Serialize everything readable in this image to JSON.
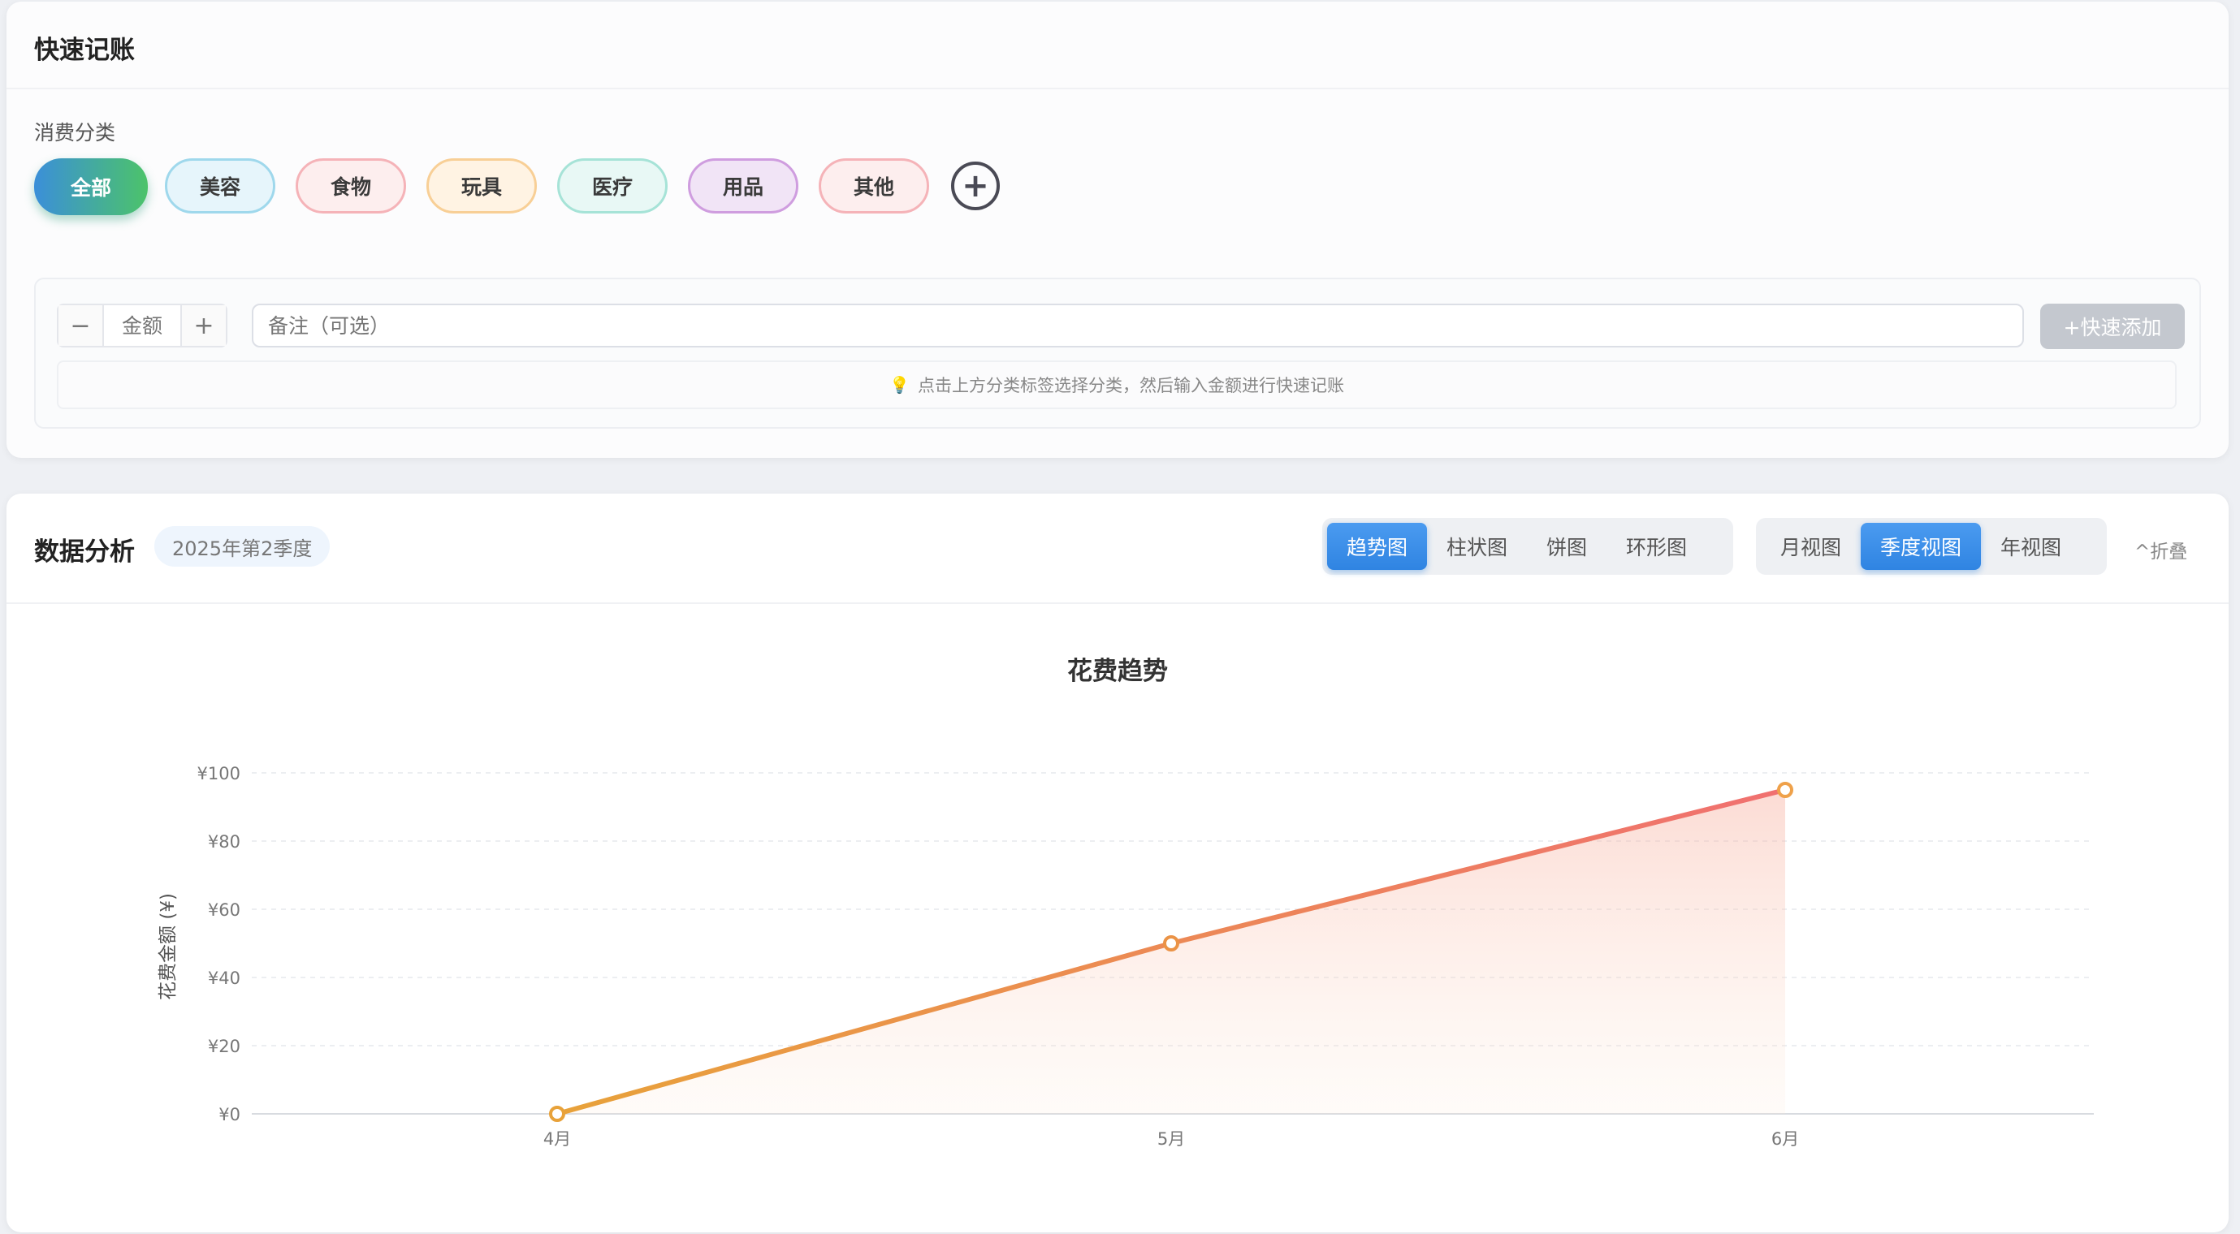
{
  "quick_add": {
    "title": "快速记账",
    "category_label": "消费分类",
    "categories": [
      {
        "label": "全部",
        "active": true,
        "bg": "#3b8fd9",
        "border": "#4cc36a"
      },
      {
        "label": "美容",
        "active": false,
        "bg": "#e6f5fb",
        "border": "#9fd8ec"
      },
      {
        "label": "食物",
        "active": false,
        "bg": "#fdeeee",
        "border": "#f5b3b8"
      },
      {
        "label": "玩具",
        "active": false,
        "bg": "#fff3e3",
        "border": "#f8cf96"
      },
      {
        "label": "医疗",
        "active": false,
        "bg": "#e8f8f5",
        "border": "#a6e3d7"
      },
      {
        "label": "用品",
        "active": false,
        "bg": "#f1e4f6",
        "border": "#cf9ddf"
      },
      {
        "label": "其他",
        "active": false,
        "bg": "#fdeeee",
        "border": "#f5b3b8"
      }
    ],
    "add_category_icon": "+",
    "minus_label": "−",
    "plus_label": "+",
    "amount_placeholder": "金额",
    "note_placeholder": "备注（可选）",
    "submit_label": "+快速添加",
    "hint_icon": "lightbulb-icon",
    "hint_text": "点击上方分类标签选择分类，然后输入金额进行快速记账"
  },
  "analysis": {
    "title": "数据分析",
    "period": "2025年第2季度",
    "chart_types": [
      {
        "label": "趋势图",
        "active": true
      },
      {
        "label": "柱状图",
        "active": false
      },
      {
        "label": "饼图",
        "active": false
      },
      {
        "label": "环形图",
        "active": false
      }
    ],
    "views": [
      {
        "label": "月视图",
        "active": false
      },
      {
        "label": "季度视图",
        "active": true
      },
      {
        "label": "年视图",
        "active": false
      }
    ],
    "collapse_label": "^折叠"
  },
  "chart_data": {
    "type": "line",
    "title": "花费趋势",
    "ylabel": "花费金额 (¥)",
    "xlabel": "",
    "categories": [
      "4月",
      "5月",
      "6月"
    ],
    "values": [
      0,
      50,
      95
    ],
    "ylim": [
      0,
      100
    ],
    "yticks": [
      "¥0",
      "¥20",
      "¥40",
      "¥60",
      "¥80",
      "¥100"
    ],
    "ytick_values": [
      0,
      20,
      40,
      60,
      80,
      100
    ],
    "grid": true,
    "line_colors": [
      "#e8a23a",
      "#f07070"
    ]
  }
}
